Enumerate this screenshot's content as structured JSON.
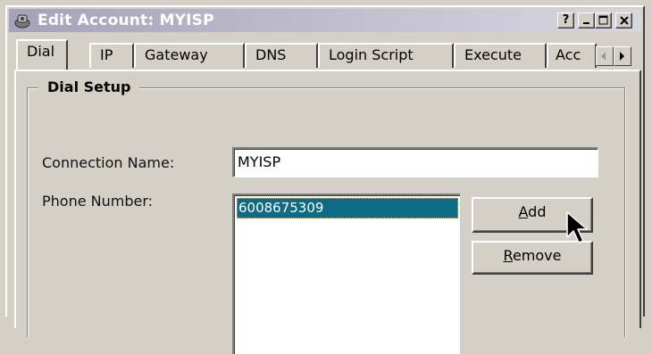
{
  "window": {
    "title": "Edit Account: MYISP",
    "controls": {
      "help": "?",
      "minimize": "minimize-icon",
      "maximize": "maximize-icon",
      "close": "close-icon"
    }
  },
  "tabs": [
    {
      "label": "Dial",
      "active": true
    },
    {
      "label": "IP",
      "active": false
    },
    {
      "label": "Gateway",
      "active": false
    },
    {
      "label": "DNS",
      "active": false
    },
    {
      "label": "Login Script",
      "active": false
    },
    {
      "label": "Execute",
      "active": false
    },
    {
      "label": "Acc",
      "active": false
    }
  ],
  "dial_setup": {
    "group_title": "Dial Setup",
    "connection_name_label": "Connection Name:",
    "connection_name_value": "MYISP",
    "phone_number_label": "Phone Number:",
    "phone_numbers": [
      "6008675309"
    ],
    "add_button": {
      "mnemonic": "A",
      "rest": "dd"
    },
    "remove_button": {
      "mnemonic": "R",
      "rest": "emove"
    }
  },
  "colors": {
    "face": "#d4d0c8",
    "selection": "#0d6a84",
    "title_gradient_start": "#a5a2b9",
    "title_gradient_end": "#d7d6df"
  }
}
